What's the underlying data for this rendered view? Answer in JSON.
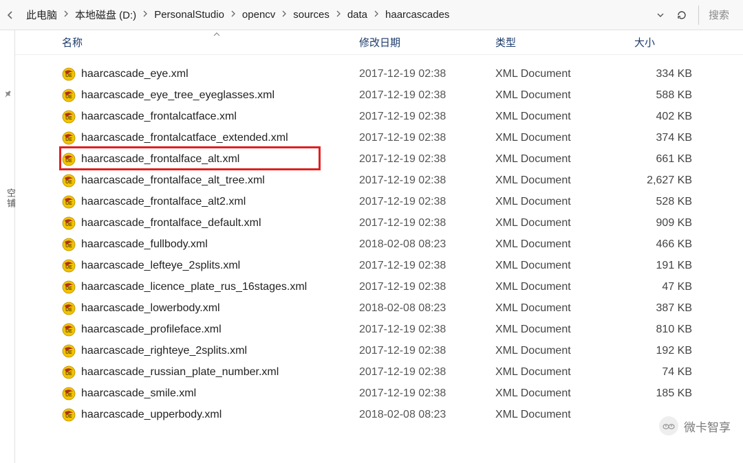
{
  "toolbar": {
    "breadcrumb": [
      "此电脑",
      "本地磁盘 (D:)",
      "PersonalStudio",
      "opencv",
      "sources",
      "data",
      "haarcascades"
    ],
    "search_placeholder": "搜索"
  },
  "sidebar": {
    "pin_title": "固定",
    "group_label": "空铺"
  },
  "columns": {
    "name": "名称",
    "date": "修改日期",
    "type": "类型",
    "size": "大小"
  },
  "files": [
    {
      "name": "haarcascade_eye.xml",
      "date": "2017-12-19 02:38",
      "type": "XML Document",
      "size": "334 KB"
    },
    {
      "name": "haarcascade_eye_tree_eyeglasses.xml",
      "date": "2017-12-19 02:38",
      "type": "XML Document",
      "size": "588 KB"
    },
    {
      "name": "haarcascade_frontalcatface.xml",
      "date": "2017-12-19 02:38",
      "type": "XML Document",
      "size": "402 KB"
    },
    {
      "name": "haarcascade_frontalcatface_extended.xml",
      "date": "2017-12-19 02:38",
      "type": "XML Document",
      "size": "374 KB"
    },
    {
      "name": "haarcascade_frontalface_alt.xml",
      "date": "2017-12-19 02:38",
      "type": "XML Document",
      "size": "661 KB",
      "highlighted": true
    },
    {
      "name": "haarcascade_frontalface_alt_tree.xml",
      "date": "2017-12-19 02:38",
      "type": "XML Document",
      "size": "2,627 KB"
    },
    {
      "name": "haarcascade_frontalface_alt2.xml",
      "date": "2017-12-19 02:38",
      "type": "XML Document",
      "size": "528 KB"
    },
    {
      "name": "haarcascade_frontalface_default.xml",
      "date": "2017-12-19 02:38",
      "type": "XML Document",
      "size": "909 KB"
    },
    {
      "name": "haarcascade_fullbody.xml",
      "date": "2018-02-08 08:23",
      "type": "XML Document",
      "size": "466 KB"
    },
    {
      "name": "haarcascade_lefteye_2splits.xml",
      "date": "2017-12-19 02:38",
      "type": "XML Document",
      "size": "191 KB"
    },
    {
      "name": "haarcascade_licence_plate_rus_16stages.xml",
      "date": "2017-12-19 02:38",
      "type": "XML Document",
      "size": "47 KB"
    },
    {
      "name": "haarcascade_lowerbody.xml",
      "date": "2018-02-08 08:23",
      "type": "XML Document",
      "size": "387 KB"
    },
    {
      "name": "haarcascade_profileface.xml",
      "date": "2017-12-19 02:38",
      "type": "XML Document",
      "size": "810 KB"
    },
    {
      "name": "haarcascade_righteye_2splits.xml",
      "date": "2017-12-19 02:38",
      "type": "XML Document",
      "size": "192 KB"
    },
    {
      "name": "haarcascade_russian_plate_number.xml",
      "date": "2017-12-19 02:38",
      "type": "XML Document",
      "size": "74 KB"
    },
    {
      "name": "haarcascade_smile.xml",
      "date": "2017-12-19 02:38",
      "type": "XML Document",
      "size": "185 KB"
    },
    {
      "name": "haarcascade_upperbody.xml",
      "date": "2018-02-08 08:23",
      "type": "XML Document",
      "size": ""
    }
  ],
  "watermark": {
    "text": "微卡智享"
  }
}
